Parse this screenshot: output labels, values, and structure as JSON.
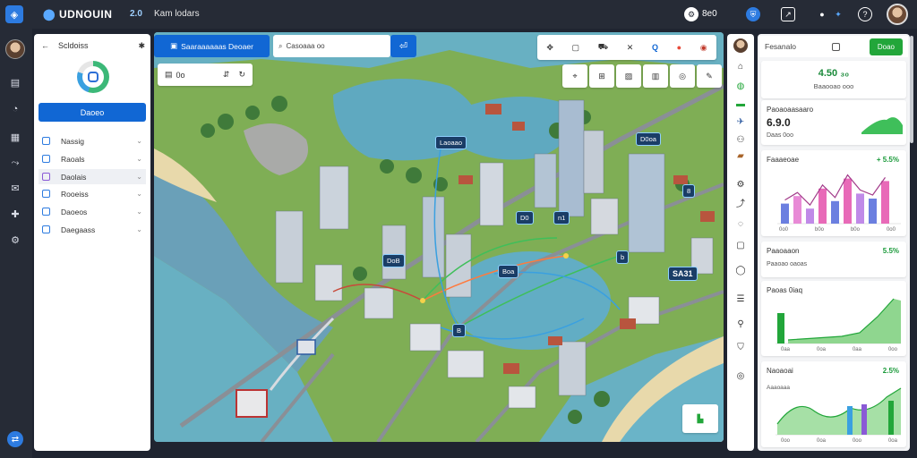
{
  "topbar": {
    "brand": "UDNOUIN",
    "version": "2.0",
    "breadcrumb": "Kam lodars",
    "status_text": "8e0"
  },
  "rail": {
    "items": [
      "cube-icon",
      "layers-icon",
      "tag-icon",
      "chart-icon",
      "route-icon",
      "chat-icon",
      "puzzle-icon",
      "settings-icon"
    ]
  },
  "left_panel": {
    "back_label": "Scldoiss",
    "primary_button": "Daoeo",
    "items": [
      {
        "label": "Nassig"
      },
      {
        "label": "Raoals"
      },
      {
        "label": "Daolais"
      },
      {
        "label": "Rooeiss"
      },
      {
        "label": "Daoeos"
      },
      {
        "label": "Daegaass"
      }
    ]
  },
  "map_toolbar": {
    "search_button": "Saaraaaaaas  Deoaer",
    "search_placeholder": "Casoaaa oo",
    "filter_label": "0o"
  },
  "map_labels": [
    {
      "text": "Laoaao"
    },
    {
      "text": "D0oa"
    },
    {
      "text": "DoB"
    },
    {
      "text": "n1"
    },
    {
      "text": "D0"
    },
    {
      "text": "Boa"
    },
    {
      "text": "B"
    },
    {
      "text": "8"
    },
    {
      "text": "b"
    },
    {
      "text": "SA31"
    }
  ],
  "right_panel": {
    "header_label": "Fesanalo",
    "header_button": "Doao",
    "kpi1": {
      "value": "4.50 ₃₀",
      "sub": "Baaooao ooo"
    },
    "kpi2": {
      "title": "Paoaoaasaaro",
      "value": "6.9.0",
      "sub": "Daas 0oo"
    },
    "card3": {
      "title": "Faaaeoae",
      "value": "+ 5.5%",
      "bars": [
        40,
        55,
        30,
        70,
        45,
        90,
        60,
        50,
        85
      ],
      "ticks": [
        "0o0",
        "b0o",
        "b0o",
        "0o0"
      ]
    },
    "card4": {
      "title": "Paaoaaon",
      "value": "5.5%",
      "sub": "Paaoao oaoas"
    },
    "card5": {
      "title": "Paoas 0iaq",
      "value": "",
      "ticks": [
        "0aa",
        "0oa",
        "0aa",
        "0oo"
      ]
    },
    "card6": {
      "title": "Naoaoai",
      "value": "2.5%",
      "sub": "Aaaoaaa",
      "ticks": [
        "0oo",
        "0oa",
        "0oo",
        "0oa"
      ]
    }
  }
}
